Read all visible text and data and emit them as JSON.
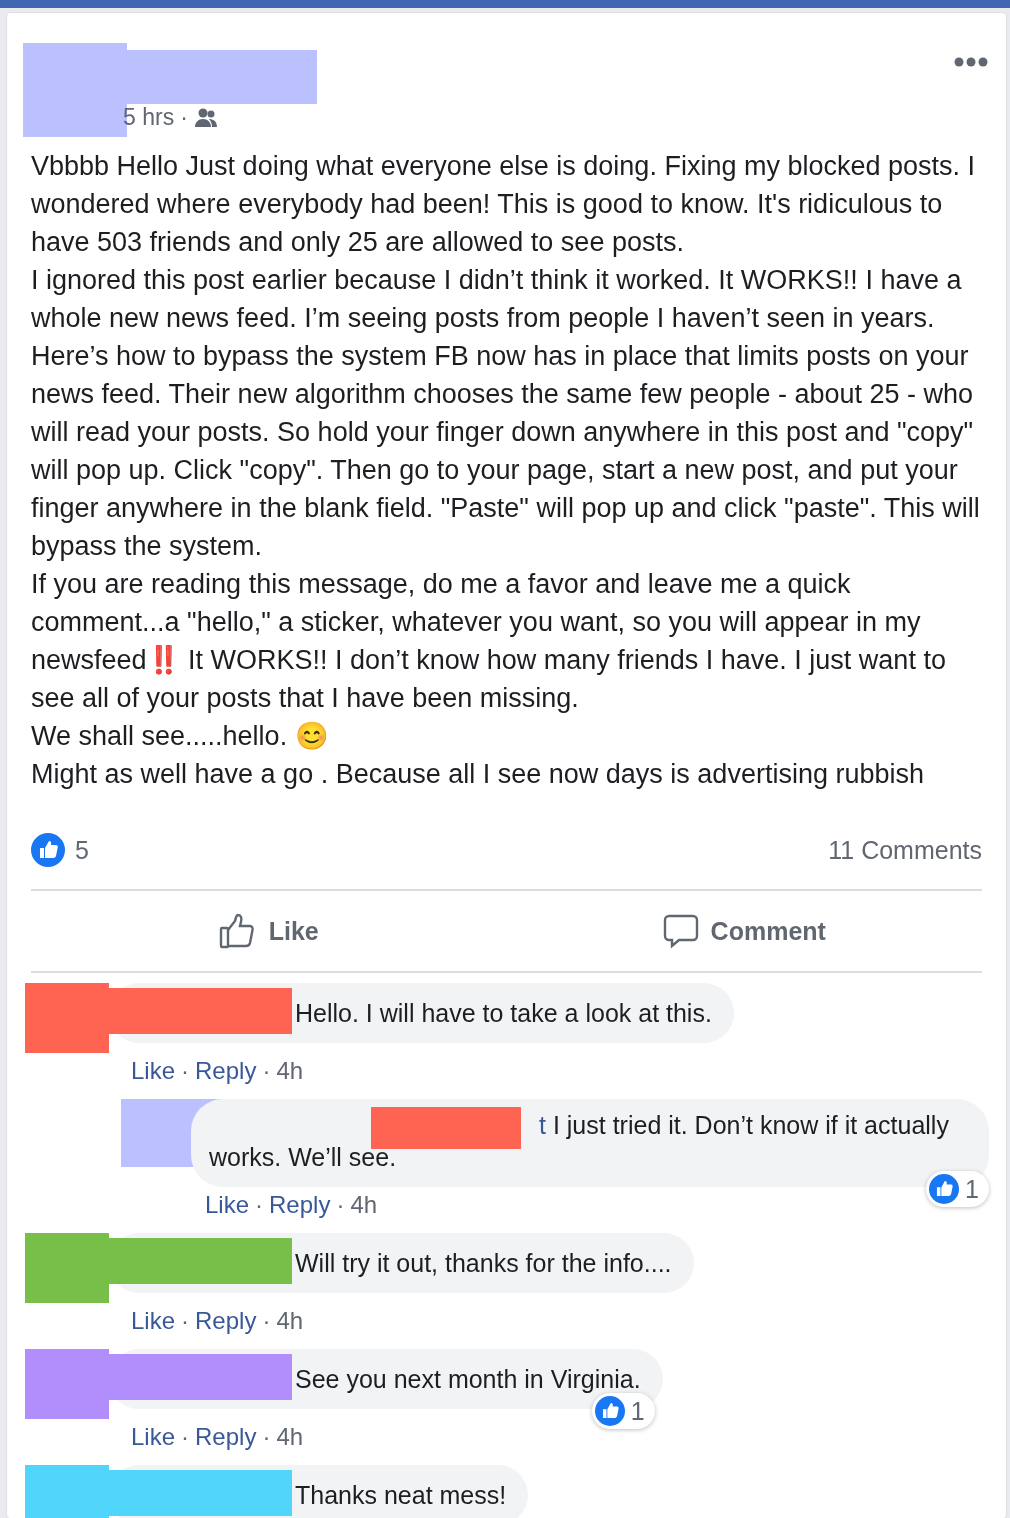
{
  "post": {
    "time": "5 hrs",
    "separator": "·",
    "color": "#bbc1fe",
    "paragraphs": [
      "Vbbbb Hello Just doing what everyone else is doing. Fixing my blocked posts. I wondered where everybody had been! This is good to know. It's ridiculous to have 503 friends and only 25 are allowed to see posts.",
      "I ignored this post earlier because I didn’t think it worked. It WORKS!! I have a whole new news feed. I’m seeing posts from people I haven’t seen in years. Here’s how to bypass the system FB now has in place that limits posts on your news feed. Their new algorithm chooses the same few people - about 25 - who will read your posts. So hold your finger down anywhere in this post and \"copy\" will pop up. Click \"copy\". Then go to your page, start a new post, and put your finger anywhere in the blank field. \"Paste\" will pop up and click \"paste\". This will bypass the system.",
      "If you are reading this message, do me a favor and leave me a quick comment...a \"hello,\" a sticker, whatever you want, so you will appear in my newsfeed‼️ It WORKS!! I don’t know how many friends I have. I just want to see all of your posts that I have been missing.",
      "We shall see.....hello. 😊",
      "Might as well have a go . Because all I see now days is advertising rubbish"
    ],
    "like_count": "5",
    "comment_count": "11 Comments",
    "actions": [
      {
        "kind": "like",
        "label": "Like"
      },
      {
        "kind": "comment",
        "label": "Comment"
      }
    ]
  },
  "comments": [
    {
      "color": "#ff6352",
      "text": "Hello. I will have to take a look at this.",
      "like": "Like",
      "separator": "·",
      "reply": "Reply",
      "time": "4h",
      "children": [
        {
          "color": "#bbc1fe",
          "extra_blocks": [
            {
              "color": "#ff6352"
            }
          ],
          "name_fragment": "t",
          "text": "I just tried it. Don’t know if it actually works. We’ll see.",
          "like": "Like",
          "separator": "·",
          "reply": "Reply",
          "time": "4h",
          "reactions": "1"
        }
      ]
    },
    {
      "color": "#77bf48",
      "text": "Will try it out, thanks for the info....",
      "like": "Like",
      "separator": "·",
      "reply": "Reply",
      "time": "4h"
    },
    {
      "color": "#b28efc",
      "text": "See you next month in Virginia.",
      "like": "Like",
      "separator": "·",
      "reply": "Reply",
      "time": "4h",
      "reactions": "1"
    },
    {
      "color": "#51d5fb",
      "text": "Thanks neat mess!"
    }
  ]
}
